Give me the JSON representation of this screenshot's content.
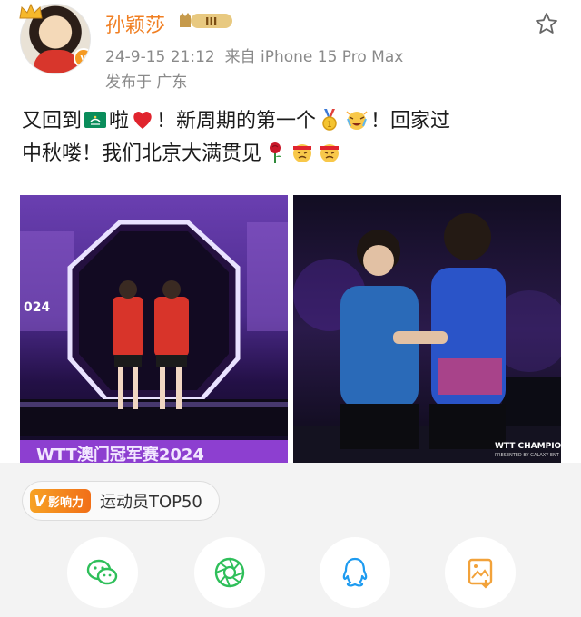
{
  "post": {
    "username": "孙颖莎",
    "vip_level": "III",
    "timestamp": "24-9-15 21:12",
    "source": "来自 iPhone 15 Pro Max",
    "location": "发布于 广东",
    "text_line1_a": "又回到",
    "text_line1_b": "啦",
    "text_line1_c": "！新周期的第一个",
    "text_line1_d": "！回家过",
    "text_line2_a": "中秋喽！我们北京大满贯见",
    "photo1_banner": "WTT澳门冠军赛2024",
    "photo1_year": "024",
    "photo2_banner": "WTT CHAMPIONS",
    "photo2_sub": "PRESENTED BY GALAXY ENT"
  },
  "influence": {
    "badge": "影响力",
    "label": "运动员TOP50"
  },
  "colors": {
    "username": "#f07e21",
    "wechat": "#2fbf5a",
    "moments": "#2fbf5a",
    "qq": "#1e9bf0",
    "save": "#f2a23a"
  },
  "icons": [
    "wechat-icon",
    "moments-icon",
    "qq-icon",
    "save-image-icon"
  ]
}
